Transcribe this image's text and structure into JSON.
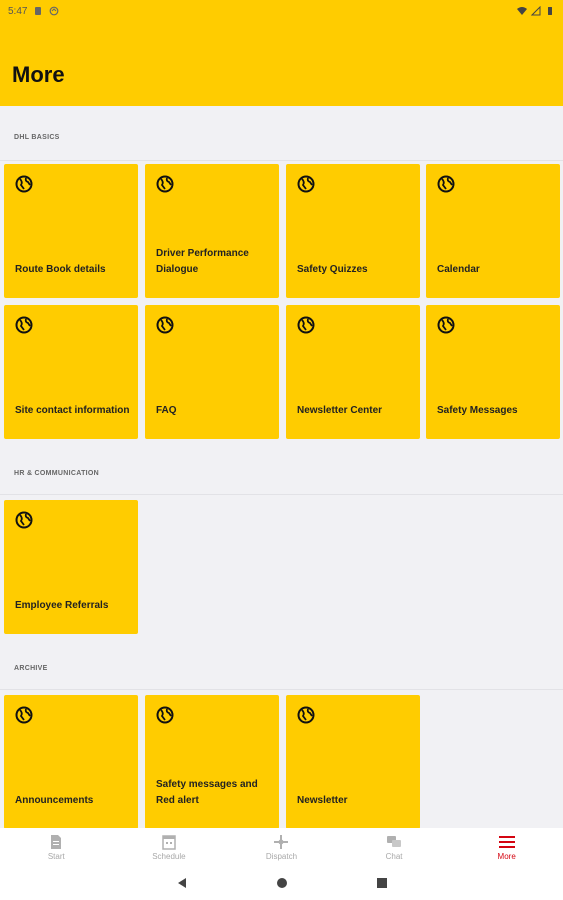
{
  "status_bar": {
    "time": "5:47"
  },
  "header": {
    "title": "More"
  },
  "sections": [
    {
      "label": "DHL BASICS",
      "tiles": [
        "Route Book details",
        "Driver Performance Dialogue",
        "Safety Quizzes",
        "Calendar",
        "Site contact information",
        "FAQ",
        "Newsletter Center",
        "Safety Messages"
      ]
    },
    {
      "label": "HR & COMMUNICATION",
      "tiles": [
        "Employee Referrals"
      ]
    },
    {
      "label": "ARCHIVE",
      "tiles": [
        "Announcements",
        "Safety messages and Red alert",
        "Newsletter"
      ]
    }
  ],
  "tile_icon": "globe-icon",
  "bottom_nav": [
    {
      "label": "Start",
      "icon": "document-icon"
    },
    {
      "label": "Schedule",
      "icon": "calendar-icon"
    },
    {
      "label": "Dispatch",
      "icon": "dispatch-icon"
    },
    {
      "label": "Chat",
      "icon": "chat-icon"
    },
    {
      "label": "More",
      "icon": "menu-icon",
      "active": true
    }
  ],
  "colors": {
    "brand_yellow": "#ffcc00",
    "brand_red": "#d40511",
    "background": "#f1f1f4"
  }
}
